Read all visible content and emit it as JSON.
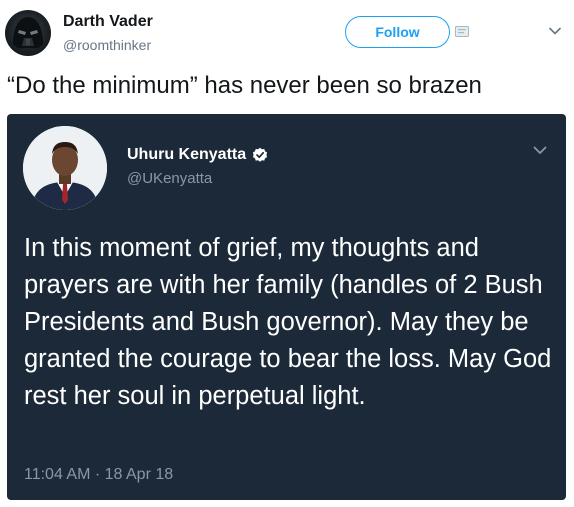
{
  "outer_tweet": {
    "author_name": "Darth Vader",
    "author_handle": "@roomthinker",
    "follow_label": "Follow",
    "text": "“Do the minimum” has never been so brazen",
    "avatar_icon": "darth-vader-helmet-icon",
    "options_icon": "chevron-down-icon"
  },
  "quoted_tweet": {
    "author_name": "Uhuru Kenyatta",
    "author_handle": "@UKenyatta",
    "verified_icon": "verified-badge-icon",
    "text": "In this moment of grief, my thoughts and prayers are with her family (handles of 2 Bush Presidents and Bush governor). May they be granted the courage to bear the loss. May God rest her soul in perpetual light.",
    "timestamp": "11:04 AM · 18 Apr 18",
    "options_icon": "chevron-down-icon"
  },
  "colors": {
    "accent": "#1da1f2",
    "card_background": "#1c2938",
    "muted_text": "#8899a6"
  }
}
